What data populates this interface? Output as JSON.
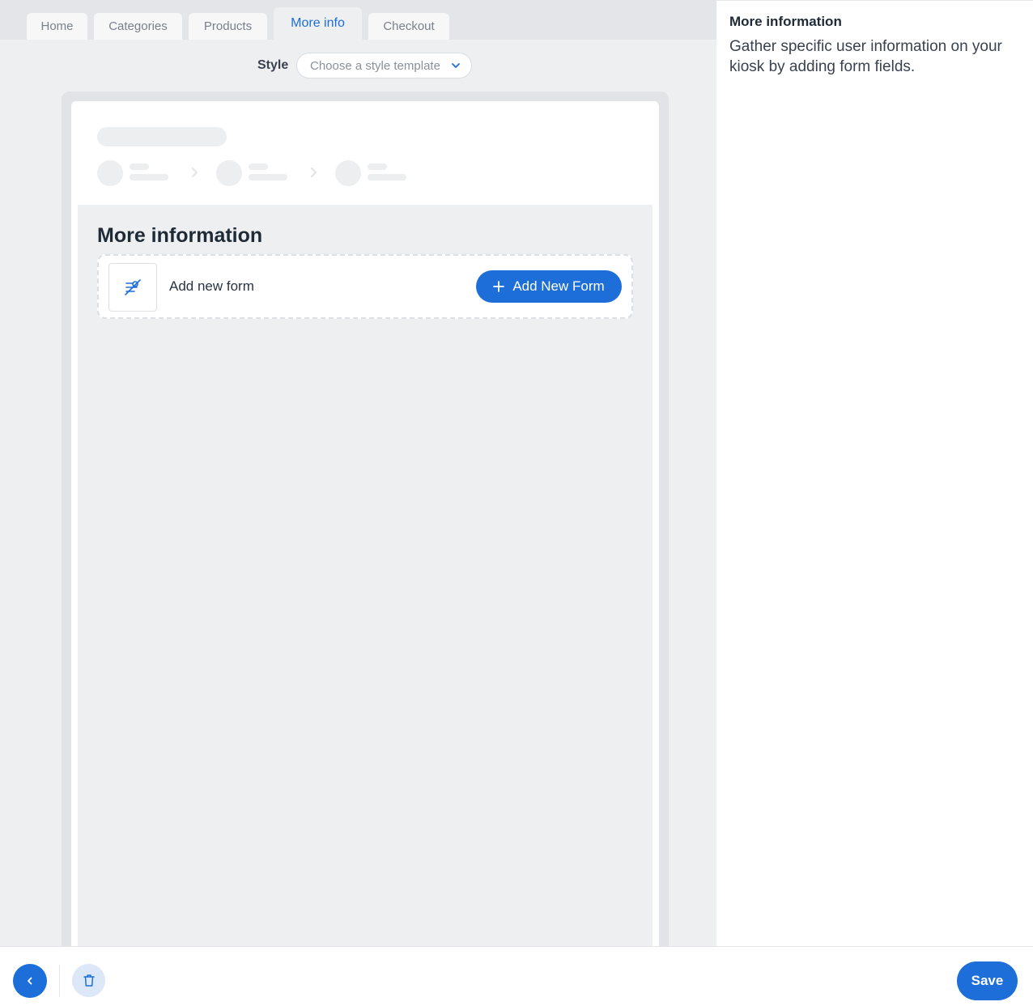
{
  "tabs": [
    {
      "label": "Home"
    },
    {
      "label": "Categories"
    },
    {
      "label": "Products"
    },
    {
      "label": "More info",
      "active": true
    },
    {
      "label": "Checkout"
    }
  ],
  "style": {
    "label": "Style",
    "placeholder": "Choose a style template"
  },
  "preview": {
    "section_title": "More information",
    "form_card": {
      "label": "Add new form",
      "button_label": "Add New Form",
      "icon": "form-off-icon"
    }
  },
  "right_panel": {
    "title": "More information",
    "description": "Gather specific user information on your kiosk by adding form fields."
  },
  "footer": {
    "save_label": "Save",
    "back_icon": "chevron-left-icon",
    "delete_icon": "trash-icon"
  },
  "colors": {
    "accent": "#1d6ed8",
    "background": "#eeeff1",
    "panel": "#ffffff"
  }
}
